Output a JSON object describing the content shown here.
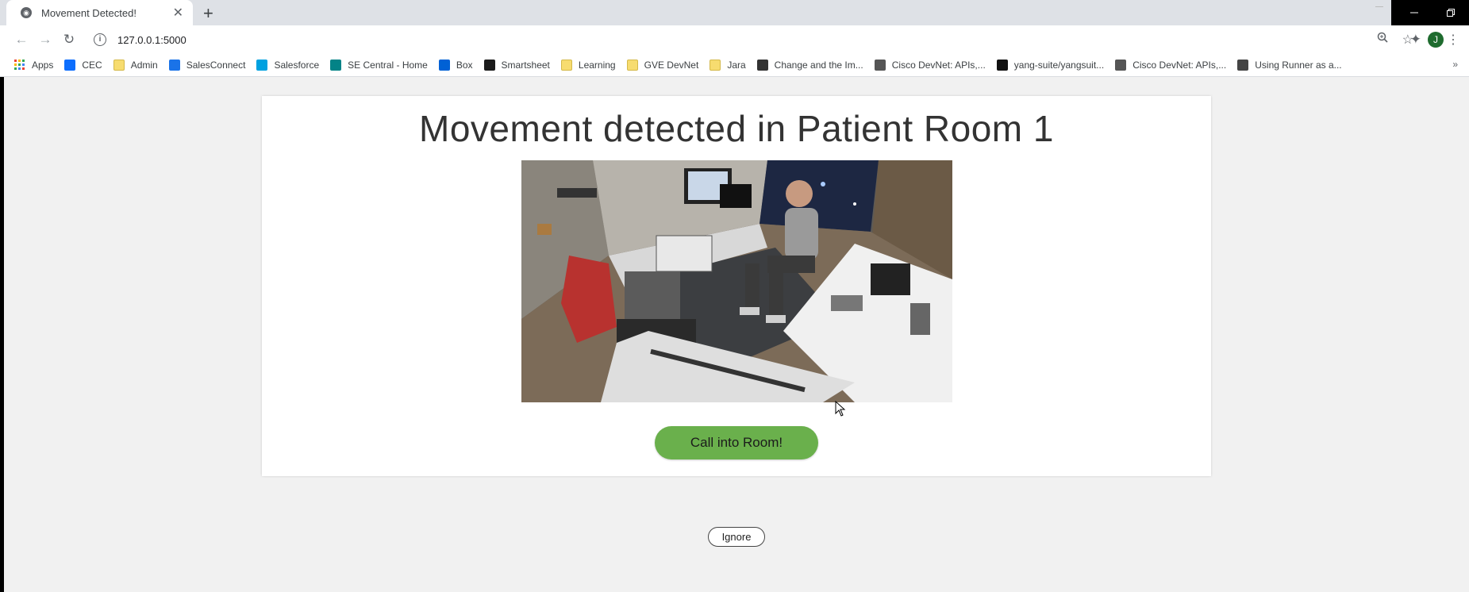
{
  "browser": {
    "tab_title": "Movement Detected!",
    "tab_close": "✕",
    "new_tab": "+",
    "url": "127.0.0.1:5000",
    "profile_initial": "J",
    "window_controls": [
      "–",
      "❐",
      "✕"
    ]
  },
  "bookmarks": [
    {
      "label": "Apps",
      "icon": "apps-grid-icon",
      "color": "#4285f4"
    },
    {
      "label": "CEC",
      "icon": "cec-icon",
      "color": "#0d6efd"
    },
    {
      "label": "Admin",
      "icon": "folder-icon",
      "color": "#f7dc6f"
    },
    {
      "label": "SalesConnect",
      "icon": "salesconnect-icon",
      "color": "#1a73e8"
    },
    {
      "label": "Salesforce",
      "icon": "salesforce-cloud-icon",
      "color": "#00a1e0"
    },
    {
      "label": "SE Central - Home",
      "icon": "sharepoint-icon",
      "color": "#038387"
    },
    {
      "label": "Box",
      "icon": "box-icon",
      "color": "#0061d5"
    },
    {
      "label": "Smartsheet",
      "icon": "smartsheet-icon",
      "color": "#1b1b1b"
    },
    {
      "label": "Learning",
      "icon": "folder-icon",
      "color": "#f7dc6f"
    },
    {
      "label": "GVE DevNet",
      "icon": "folder-icon",
      "color": "#f7dc6f"
    },
    {
      "label": "Jara",
      "icon": "folder-icon",
      "color": "#f7dc6f"
    },
    {
      "label": "Change and the Im...",
      "icon": "cisco-icon",
      "color": "#333333"
    },
    {
      "label": "Cisco DevNet: APIs,...",
      "icon": "cisco-icon",
      "color": "#555555"
    },
    {
      "label": "yang-suite/yangsuit...",
      "icon": "github-icon",
      "color": "#111111"
    },
    {
      "label": "Cisco DevNet: APIs,...",
      "icon": "cisco-icon",
      "color": "#555555"
    },
    {
      "label": "Using Runner as a...",
      "icon": "doc-icon",
      "color": "#444444"
    }
  ],
  "bookmarks_overflow": "»",
  "alert": {
    "heading": "Movement detected in Patient Room 1",
    "call_button": "Call into Room!",
    "ignore_button": "Ignore"
  },
  "colors": {
    "call_button": "#6ab04c",
    "page_background": "#f1f1f1"
  }
}
